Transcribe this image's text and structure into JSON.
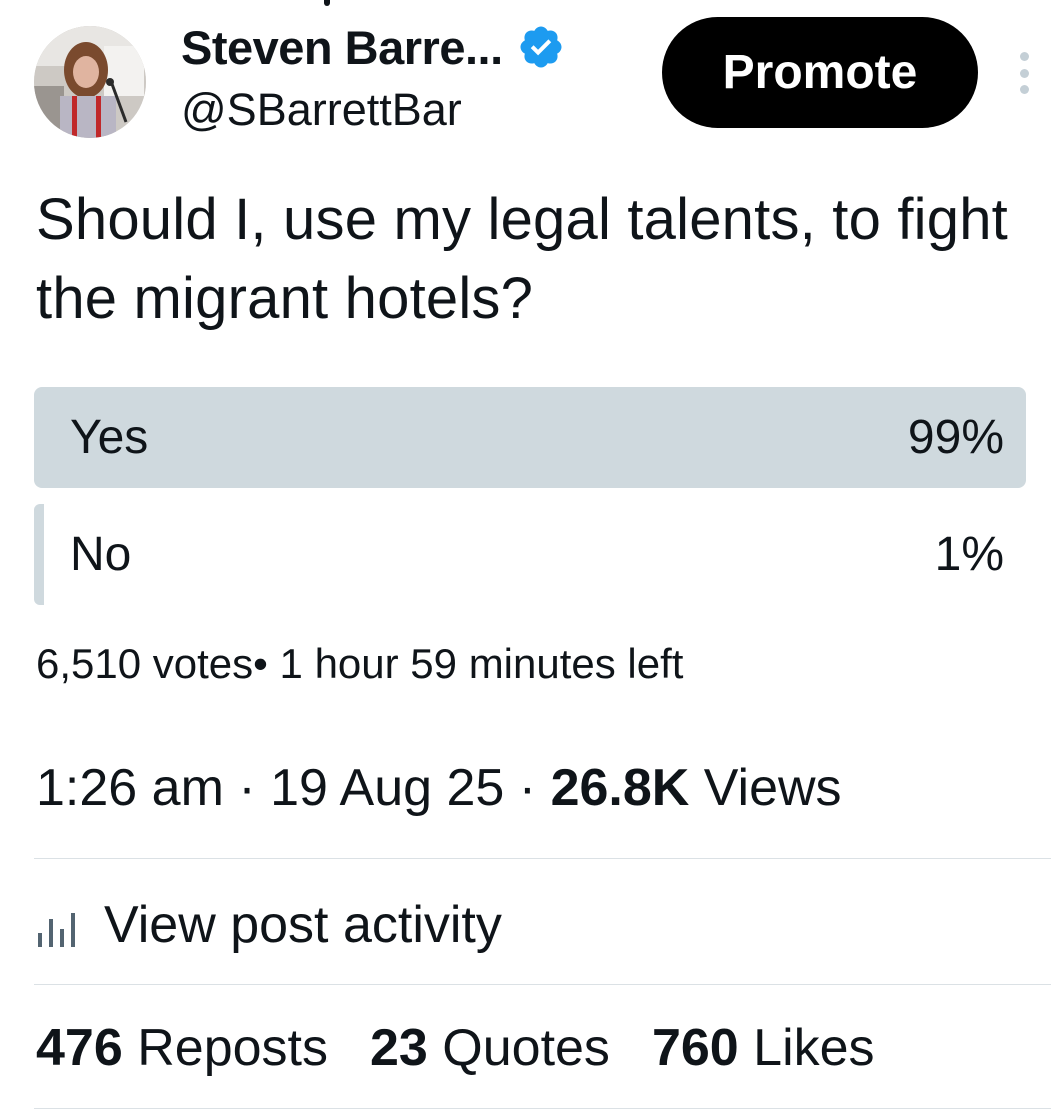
{
  "author": {
    "display_name": "Steven Barre...",
    "handle": "@SBarrettBar",
    "verified": true
  },
  "header": {
    "promote_label": "Promote"
  },
  "post": {
    "text": "Should I, use my legal talents, to fight the migrant hotels?"
  },
  "poll": {
    "options": [
      {
        "label": "Yes",
        "percent_text": "99%",
        "percent": 99
      },
      {
        "label": "No",
        "percent_text": "1%",
        "percent": 1
      }
    ],
    "votes": "6,510 votes",
    "time_left": "1 hour 59 minutes left"
  },
  "meta": {
    "time": "1:26 am",
    "date": "19 Aug 25",
    "views_count": "26.8K",
    "views_label": "Views"
  },
  "activity": {
    "label": "View post activity"
  },
  "stats": {
    "reposts_count": "476",
    "reposts_label": "Reposts",
    "quotes_count": "23",
    "quotes_label": "Quotes",
    "likes_count": "760",
    "likes_label": "Likes"
  },
  "colors": {
    "verified_blue": "#1d9bf0",
    "poll_bar": "#cfd9de",
    "button_bg": "#000000",
    "text": "#0f1419"
  }
}
